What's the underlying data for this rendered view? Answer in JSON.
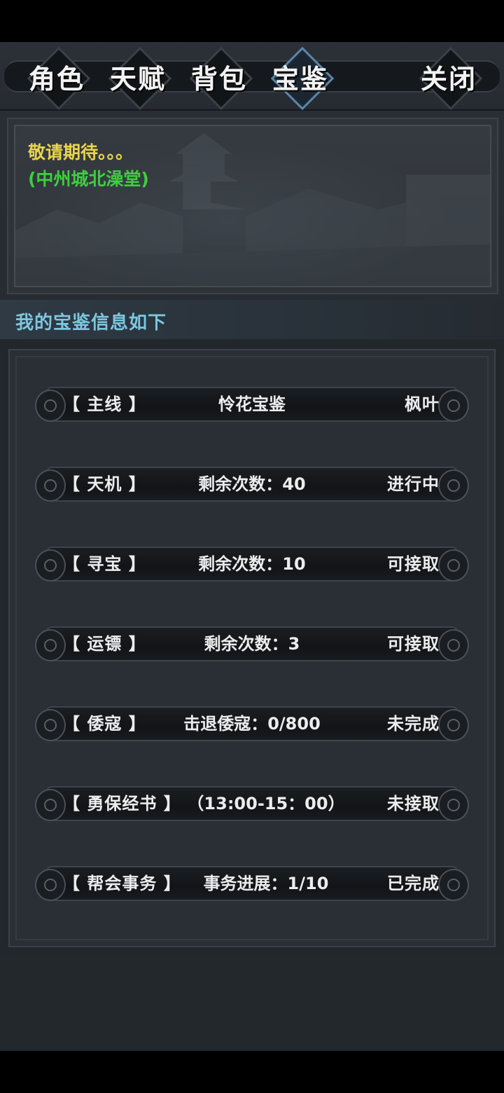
{
  "tabs": [
    {
      "label": "角色",
      "active": false
    },
    {
      "label": "天赋",
      "active": false
    },
    {
      "label": "背包",
      "active": false
    },
    {
      "label": "宝鉴",
      "active": true
    }
  ],
  "close_label": "关闭",
  "info": {
    "line1": "敬请期待。。。",
    "line2": "(中州城北澡堂)"
  },
  "section_title": "我的宝鉴信息如下",
  "rows": [
    {
      "category": "【 主线 】",
      "detail": "怜花宝鉴",
      "status": "枫叶"
    },
    {
      "category": "【 天机 】",
      "detail": "剩余次数：40",
      "status": "进行中"
    },
    {
      "category": "【 寻宝 】",
      "detail": "剩余次数：10",
      "status": "可接取"
    },
    {
      "category": "【 运镖 】",
      "detail": "剩余次数：3",
      "status": "可接取"
    },
    {
      "category": "【 倭寇 】",
      "detail": "击退倭寇：0/800",
      "status": "未完成"
    },
    {
      "category": "【 勇保经书 】",
      "detail": "（13:00-15：00）",
      "status": "未接取"
    },
    {
      "category": "【 帮会事务 】",
      "detail": "事务进展：1/10",
      "status": "已完成"
    }
  ]
}
